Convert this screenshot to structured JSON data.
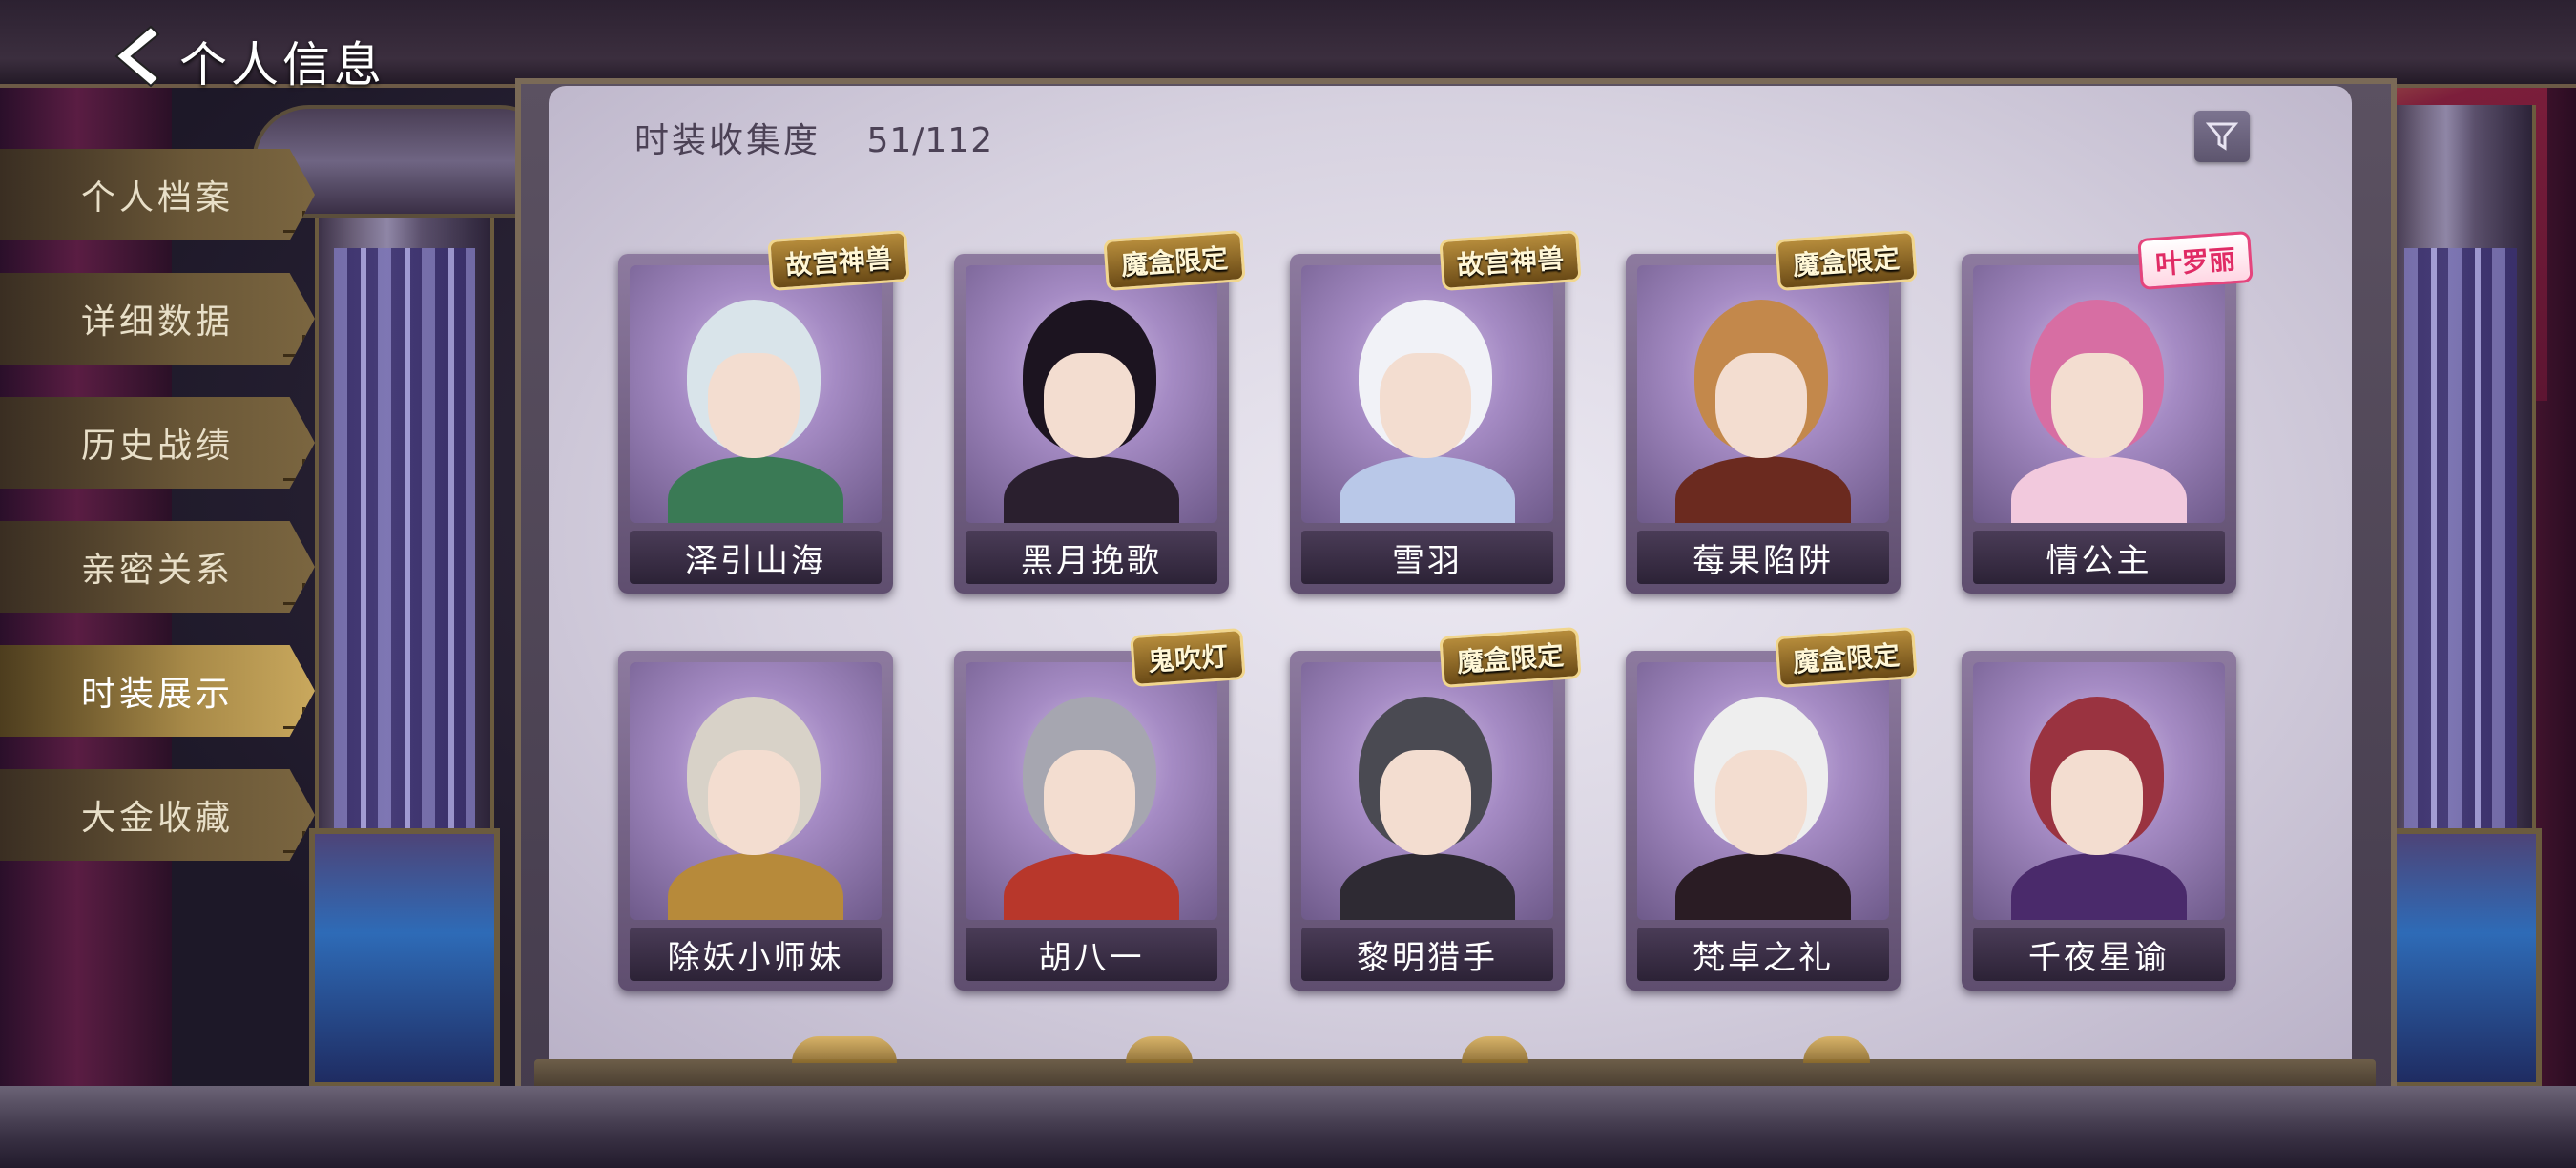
{
  "header": {
    "title": "个人信息",
    "back_icon": "chevron-left-icon"
  },
  "sidebar": {
    "items": [
      {
        "label": "个人档案",
        "active": false
      },
      {
        "label": "详细数据",
        "active": false
      },
      {
        "label": "历史战绩",
        "active": false
      },
      {
        "label": "亲密关系",
        "active": false
      },
      {
        "label": "时装展示",
        "active": true
      },
      {
        "label": "大金收藏",
        "active": false
      }
    ]
  },
  "main": {
    "collection_label": "时装收集度",
    "collection_value": "51/112",
    "filter_icon": "filter-icon",
    "cards": [
      {
        "name": "泽引山海",
        "badge": "故宫神兽",
        "badge_style": "gold",
        "hair": "#d9e4ea",
        "outfit": "#3a7a55"
      },
      {
        "name": "黑月挽歌",
        "badge": "魔盒限定",
        "badge_style": "gold",
        "hair": "#1c1420",
        "outfit": "#2a1f2e"
      },
      {
        "name": "雪羽",
        "badge": "故宫神兽",
        "badge_style": "gold",
        "hair": "#f1f2f7",
        "outfit": "#b9c8e8"
      },
      {
        "name": "莓果陷阱",
        "badge": "魔盒限定",
        "badge_style": "gold",
        "hair": "#c3884b",
        "outfit": "#6b2a1f"
      },
      {
        "name": "情公主",
        "badge": "叶罗丽",
        "badge_style": "pink",
        "hair": "#d76ea3",
        "outfit": "#f2c9dd"
      },
      {
        "name": "除妖小师妹",
        "badge": "",
        "badge_style": "",
        "hair": "#d8d2c8",
        "outfit": "#b78a3a"
      },
      {
        "name": "胡八一",
        "badge": "鬼吹灯",
        "badge_style": "gold",
        "hair": "#a6a6b0",
        "outfit": "#b8372b"
      },
      {
        "name": "黎明猎手",
        "badge": "魔盒限定",
        "badge_style": "gold",
        "hair": "#4a4a52",
        "outfit": "#2e2a33"
      },
      {
        "name": "梵卓之礼",
        "badge": "魔盒限定",
        "badge_style": "gold",
        "hair": "#eeeeee",
        "outfit": "#2a1c24"
      },
      {
        "name": "千夜星谕",
        "badge": "",
        "badge_style": "",
        "hair": "#9a3340",
        "outfit": "#4a2a6b"
      }
    ]
  }
}
